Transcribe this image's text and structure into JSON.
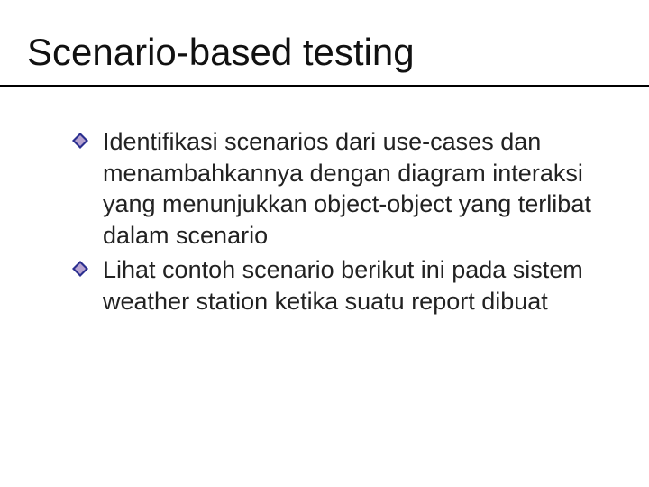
{
  "slide": {
    "title": "Scenario-based testing",
    "bullets": [
      "Identifikasi  scenarios dari use-cases dan menambahkannya dengan diagram interaksi yang menunjukkan object-object yang terlibat  dalam scenario",
      "Lihat contoh scenario berikut ini pada sistem weather station ketika suatu report dibuat"
    ]
  },
  "colors": {
    "bullet_outer": "#2b2f8f",
    "bullet_inner": "#b7a3d0"
  }
}
